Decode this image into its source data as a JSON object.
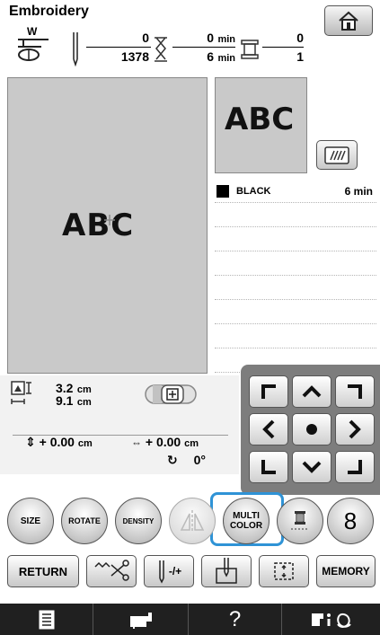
{
  "screen": {
    "title": "Embroidery"
  },
  "header": {
    "presser_foot_letter": "W",
    "stitch_current": "0",
    "stitch_total": "1378",
    "time_current": "0",
    "time_total": "6",
    "time_unit": "min",
    "color_current": "0",
    "color_total": "1"
  },
  "preview": {
    "pattern_text": "ABC"
  },
  "thumbnail": {
    "pattern_text": "ABC"
  },
  "color_list": [
    {
      "name": "BLACK",
      "time": "6 min",
      "swatch": "#000000"
    }
  ],
  "size_info": {
    "height_value": "3.2",
    "width_value": "9.1",
    "unit": "cm"
  },
  "position_info": {
    "vertical_prefix": "+ 0.00",
    "horizontal_prefix": "+ 0.00",
    "unit": "cm",
    "angle": "0°"
  },
  "edit_buttons": {
    "size": "SIZE",
    "rotate": "ROTATE",
    "density": "DENSITY",
    "multi_color_line1": "MULTI",
    "multi_color_line2": "COLOR",
    "digit": "8"
  },
  "bottom_buttons": {
    "return": "RETURN",
    "needle_adjust": "-/+",
    "memory": "MEMORY"
  },
  "bottom_bar": {
    "help": "?"
  },
  "colors": {
    "highlight": "#2f93d6",
    "preview_bg": "#c9c9c9",
    "bar_bg": "#202020"
  }
}
